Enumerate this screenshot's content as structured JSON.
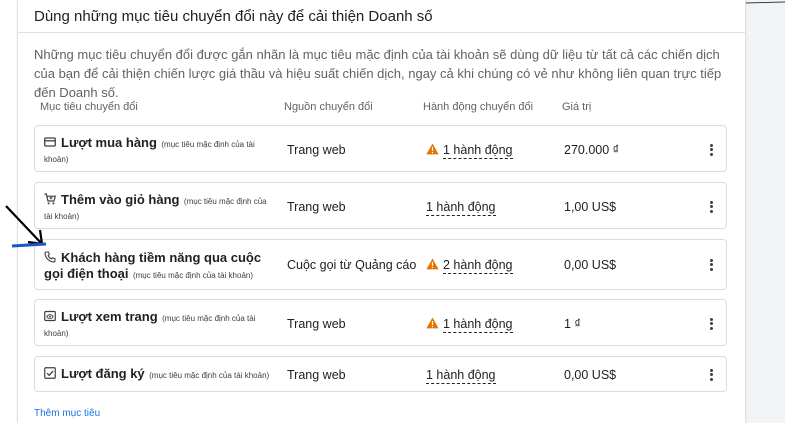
{
  "header": {
    "title": "Dùng những mục tiêu chuyển đổi này để cải thiện Doanh số"
  },
  "description": "Những mục tiêu chuyển đổi được gắn nhãn là mục tiêu mặc định của tài khoản sẽ dùng dữ liệu từ tất cả các chiến dịch của bạn để cải thiện chiến lược giá thầu và hiệu suất chiến dịch, ngay cả khi chúng có vẻ như không liên quan trực tiếp đến Doanh số.",
  "columns": {
    "goal": "Mục tiêu chuyển đổi",
    "source": "Nguồn chuyển đổi",
    "action": "Hành động chuyển đổi",
    "value": "Giá trị"
  },
  "rows": [
    {
      "icon": "credit-card-icon",
      "name": "Lượt mua hàng",
      "note": "(mục tiêu mặc định của tài khoản)",
      "source": "Trang web",
      "warning": true,
      "action": "1 hành động",
      "value": "270.000 ₫"
    },
    {
      "icon": "cart-icon",
      "name": "Thêm vào giỏ hàng",
      "note": "(mục tiêu mặc định của tài khoản)",
      "source": "Trang web",
      "warning": false,
      "action": "1 hành động",
      "value": "1,00 US$"
    },
    {
      "icon": "phone-icon",
      "name": "Khách hàng tiềm năng qua cuộc gọi điện thoại",
      "note": "(mục tiêu mặc định của tài khoản)",
      "source": "Cuộc gọi từ Quảng cáo",
      "warning": true,
      "action": "2 hành động",
      "value": "0,00 US$"
    },
    {
      "icon": "page-view-icon",
      "name": "Lượt xem trang",
      "note": "(mục tiêu mặc định của tài khoản)",
      "source": "Trang web",
      "warning": true,
      "action": "1 hành động",
      "value": "1 ₫"
    },
    {
      "icon": "checkbox-icon",
      "name": "Lượt đăng ký",
      "note": "(mục tiêu mặc định của tài khoản)",
      "source": "Trang web",
      "warning": false,
      "action": "1 hành động",
      "value": "0,00 US$"
    }
  ],
  "add_goal": "Thêm mục tiêu",
  "colors": {
    "warning": "#e37400",
    "link": "#1a73e8",
    "annotation": "#1a56c7"
  }
}
